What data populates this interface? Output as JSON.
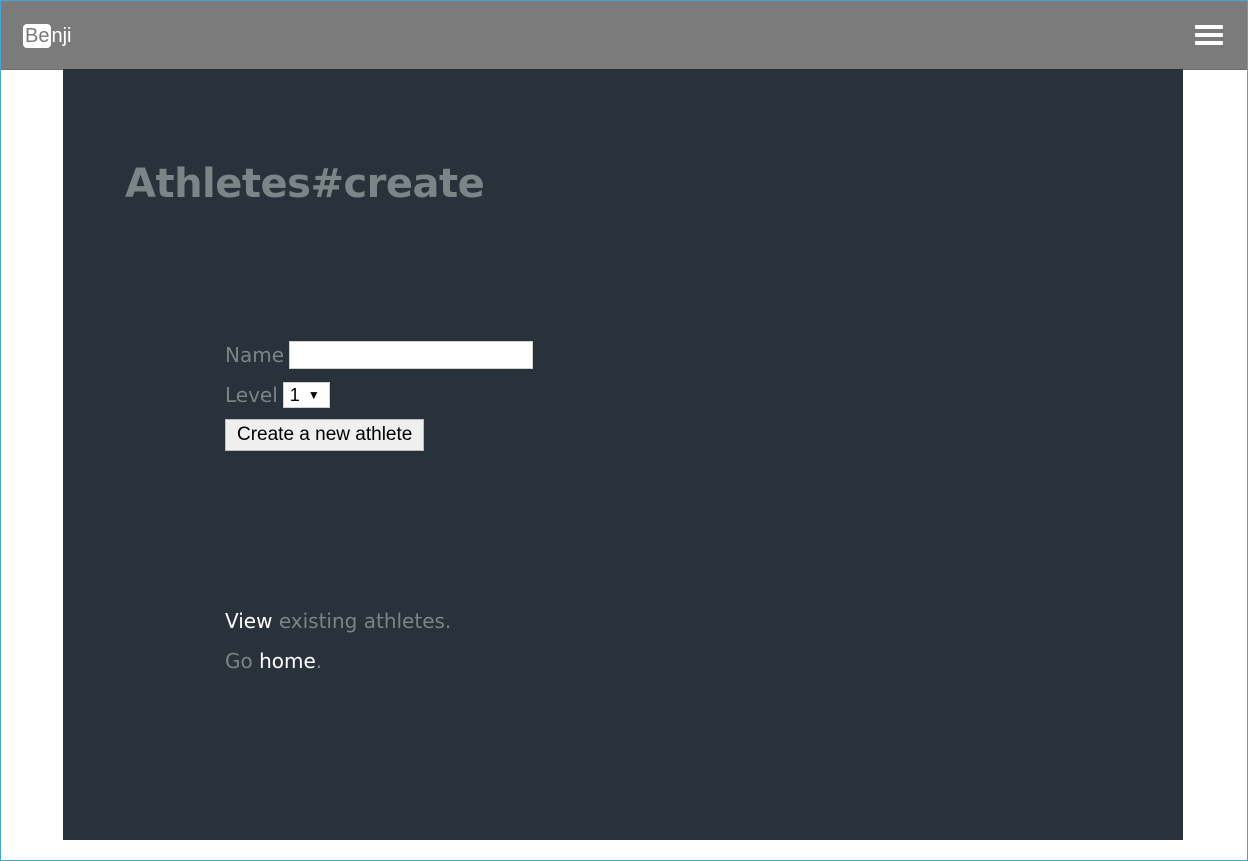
{
  "navbar": {
    "brand_box": "Be",
    "brand_rest": "nji",
    "menu_icon": "hamburger-icon"
  },
  "page": {
    "title": "Athletes#create"
  },
  "form": {
    "name_label": "Name",
    "name_value": "",
    "level_label": "Level",
    "level_value": "1",
    "submit_label": "Create a new athlete"
  },
  "links": {
    "view_link": "View",
    "view_rest": " existing athletes.",
    "go_prefix": "Go ",
    "home_link": "home",
    "go_suffix": "."
  },
  "colors": {
    "navbar_bg": "#7b7b7b",
    "panel_bg": "#29323b",
    "muted_text": "#7b8387",
    "link_text": "#ffffff"
  }
}
